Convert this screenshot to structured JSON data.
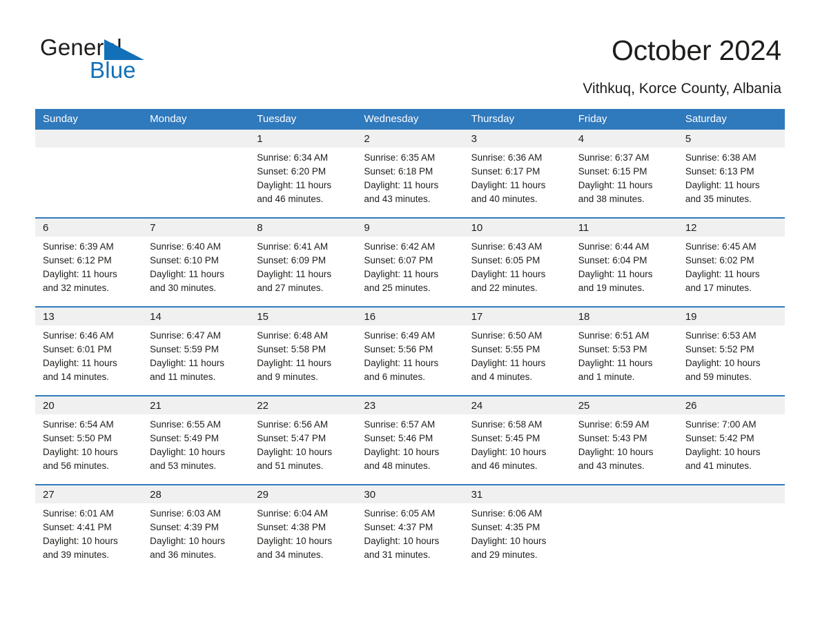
{
  "brand": {
    "word_one": "General",
    "word_two": "Blue",
    "accent_color": "#1270b8",
    "triangle_icon": "brand-triangle-icon"
  },
  "header": {
    "title": "October 2024",
    "subtitle": "Vithkuq, Korce County, Albania"
  },
  "theme": {
    "header_blue": "#2f79bd",
    "date_band_gray": "#f0f0f0",
    "text": "#1d1d1b"
  },
  "calendar": {
    "day_headers": [
      "Sunday",
      "Monday",
      "Tuesday",
      "Wednesday",
      "Thursday",
      "Friday",
      "Saturday"
    ],
    "weeks": [
      [
        {
          "date": "",
          "empty": true
        },
        {
          "date": "",
          "empty": true
        },
        {
          "date": "1",
          "sunrise": "Sunrise: 6:34 AM",
          "sunset": "Sunset: 6:20 PM",
          "daylight_1": "Daylight: 11 hours",
          "daylight_2": "and 46 minutes."
        },
        {
          "date": "2",
          "sunrise": "Sunrise: 6:35 AM",
          "sunset": "Sunset: 6:18 PM",
          "daylight_1": "Daylight: 11 hours",
          "daylight_2": "and 43 minutes."
        },
        {
          "date": "3",
          "sunrise": "Sunrise: 6:36 AM",
          "sunset": "Sunset: 6:17 PM",
          "daylight_1": "Daylight: 11 hours",
          "daylight_2": "and 40 minutes."
        },
        {
          "date": "4",
          "sunrise": "Sunrise: 6:37 AM",
          "sunset": "Sunset: 6:15 PM",
          "daylight_1": "Daylight: 11 hours",
          "daylight_2": "and 38 minutes."
        },
        {
          "date": "5",
          "sunrise": "Sunrise: 6:38 AM",
          "sunset": "Sunset: 6:13 PM",
          "daylight_1": "Daylight: 11 hours",
          "daylight_2": "and 35 minutes."
        }
      ],
      [
        {
          "date": "6",
          "sunrise": "Sunrise: 6:39 AM",
          "sunset": "Sunset: 6:12 PM",
          "daylight_1": "Daylight: 11 hours",
          "daylight_2": "and 32 minutes."
        },
        {
          "date": "7",
          "sunrise": "Sunrise: 6:40 AM",
          "sunset": "Sunset: 6:10 PM",
          "daylight_1": "Daylight: 11 hours",
          "daylight_2": "and 30 minutes."
        },
        {
          "date": "8",
          "sunrise": "Sunrise: 6:41 AM",
          "sunset": "Sunset: 6:09 PM",
          "daylight_1": "Daylight: 11 hours",
          "daylight_2": "and 27 minutes."
        },
        {
          "date": "9",
          "sunrise": "Sunrise: 6:42 AM",
          "sunset": "Sunset: 6:07 PM",
          "daylight_1": "Daylight: 11 hours",
          "daylight_2": "and 25 minutes."
        },
        {
          "date": "10",
          "sunrise": "Sunrise: 6:43 AM",
          "sunset": "Sunset: 6:05 PM",
          "daylight_1": "Daylight: 11 hours",
          "daylight_2": "and 22 minutes."
        },
        {
          "date": "11",
          "sunrise": "Sunrise: 6:44 AM",
          "sunset": "Sunset: 6:04 PM",
          "daylight_1": "Daylight: 11 hours",
          "daylight_2": "and 19 minutes."
        },
        {
          "date": "12",
          "sunrise": "Sunrise: 6:45 AM",
          "sunset": "Sunset: 6:02 PM",
          "daylight_1": "Daylight: 11 hours",
          "daylight_2": "and 17 minutes."
        }
      ],
      [
        {
          "date": "13",
          "sunrise": "Sunrise: 6:46 AM",
          "sunset": "Sunset: 6:01 PM",
          "daylight_1": "Daylight: 11 hours",
          "daylight_2": "and 14 minutes."
        },
        {
          "date": "14",
          "sunrise": "Sunrise: 6:47 AM",
          "sunset": "Sunset: 5:59 PM",
          "daylight_1": "Daylight: 11 hours",
          "daylight_2": "and 11 minutes."
        },
        {
          "date": "15",
          "sunrise": "Sunrise: 6:48 AM",
          "sunset": "Sunset: 5:58 PM",
          "daylight_1": "Daylight: 11 hours",
          "daylight_2": "and 9 minutes."
        },
        {
          "date": "16",
          "sunrise": "Sunrise: 6:49 AM",
          "sunset": "Sunset: 5:56 PM",
          "daylight_1": "Daylight: 11 hours",
          "daylight_2": "and 6 minutes."
        },
        {
          "date": "17",
          "sunrise": "Sunrise: 6:50 AM",
          "sunset": "Sunset: 5:55 PM",
          "daylight_1": "Daylight: 11 hours",
          "daylight_2": "and 4 minutes."
        },
        {
          "date": "18",
          "sunrise": "Sunrise: 6:51 AM",
          "sunset": "Sunset: 5:53 PM",
          "daylight_1": "Daylight: 11 hours",
          "daylight_2": "and 1 minute."
        },
        {
          "date": "19",
          "sunrise": "Sunrise: 6:53 AM",
          "sunset": "Sunset: 5:52 PM",
          "daylight_1": "Daylight: 10 hours",
          "daylight_2": "and 59 minutes."
        }
      ],
      [
        {
          "date": "20",
          "sunrise": "Sunrise: 6:54 AM",
          "sunset": "Sunset: 5:50 PM",
          "daylight_1": "Daylight: 10 hours",
          "daylight_2": "and 56 minutes."
        },
        {
          "date": "21",
          "sunrise": "Sunrise: 6:55 AM",
          "sunset": "Sunset: 5:49 PM",
          "daylight_1": "Daylight: 10 hours",
          "daylight_2": "and 53 minutes."
        },
        {
          "date": "22",
          "sunrise": "Sunrise: 6:56 AM",
          "sunset": "Sunset: 5:47 PM",
          "daylight_1": "Daylight: 10 hours",
          "daylight_2": "and 51 minutes."
        },
        {
          "date": "23",
          "sunrise": "Sunrise: 6:57 AM",
          "sunset": "Sunset: 5:46 PM",
          "daylight_1": "Daylight: 10 hours",
          "daylight_2": "and 48 minutes."
        },
        {
          "date": "24",
          "sunrise": "Sunrise: 6:58 AM",
          "sunset": "Sunset: 5:45 PM",
          "daylight_1": "Daylight: 10 hours",
          "daylight_2": "and 46 minutes."
        },
        {
          "date": "25",
          "sunrise": "Sunrise: 6:59 AM",
          "sunset": "Sunset: 5:43 PM",
          "daylight_1": "Daylight: 10 hours",
          "daylight_2": "and 43 minutes."
        },
        {
          "date": "26",
          "sunrise": "Sunrise: 7:00 AM",
          "sunset": "Sunset: 5:42 PM",
          "daylight_1": "Daylight: 10 hours",
          "daylight_2": "and 41 minutes."
        }
      ],
      [
        {
          "date": "27",
          "sunrise": "Sunrise: 6:01 AM",
          "sunset": "Sunset: 4:41 PM",
          "daylight_1": "Daylight: 10 hours",
          "daylight_2": "and 39 minutes."
        },
        {
          "date": "28",
          "sunrise": "Sunrise: 6:03 AM",
          "sunset": "Sunset: 4:39 PM",
          "daylight_1": "Daylight: 10 hours",
          "daylight_2": "and 36 minutes."
        },
        {
          "date": "29",
          "sunrise": "Sunrise: 6:04 AM",
          "sunset": "Sunset: 4:38 PM",
          "daylight_1": "Daylight: 10 hours",
          "daylight_2": "and 34 minutes."
        },
        {
          "date": "30",
          "sunrise": "Sunrise: 6:05 AM",
          "sunset": "Sunset: 4:37 PM",
          "daylight_1": "Daylight: 10 hours",
          "daylight_2": "and 31 minutes."
        },
        {
          "date": "31",
          "sunrise": "Sunrise: 6:06 AM",
          "sunset": "Sunset: 4:35 PM",
          "daylight_1": "Daylight: 10 hours",
          "daylight_2": "and 29 minutes."
        },
        {
          "date": "",
          "empty": true
        },
        {
          "date": "",
          "empty": true
        }
      ]
    ]
  }
}
